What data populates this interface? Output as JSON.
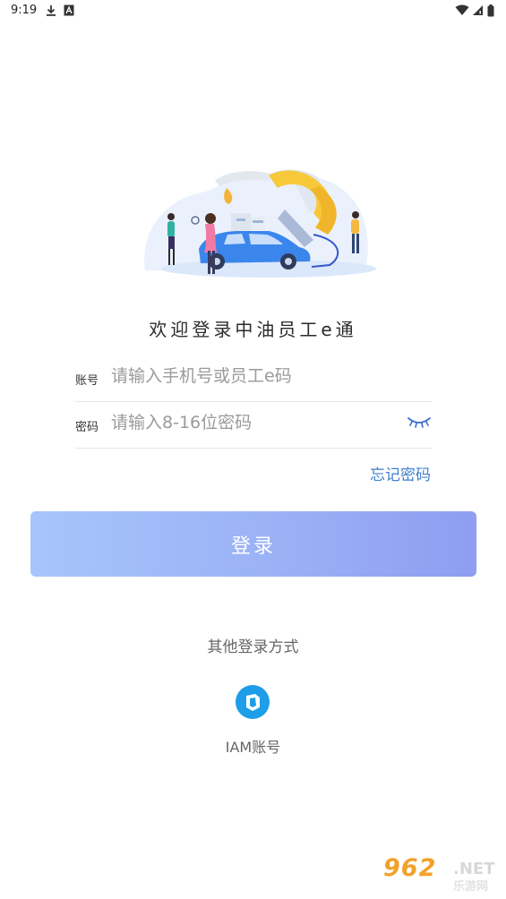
{
  "status_bar": {
    "time": "9:19"
  },
  "welcome_text": "欢迎登录中油员工e通",
  "account": {
    "label": "账号",
    "placeholder": "请输入手机号或员工e码"
  },
  "password": {
    "label": "密码",
    "placeholder": "请输入8-16位密码"
  },
  "forgot_password": "忘记密码",
  "login_button": "登录",
  "other_methods": {
    "title": "其他登录方式",
    "items": [
      {
        "label": "IAM账号",
        "icon": "iam-icon"
      }
    ]
  },
  "watermark": {
    "main": "962",
    "suffix": ".NET",
    "sub": "乐游网"
  },
  "colors": {
    "accent": "#3f7fd0",
    "button_start": "#a6c6fb",
    "button_end": "#8f9df2",
    "iam_icon": "#1e9de8"
  }
}
